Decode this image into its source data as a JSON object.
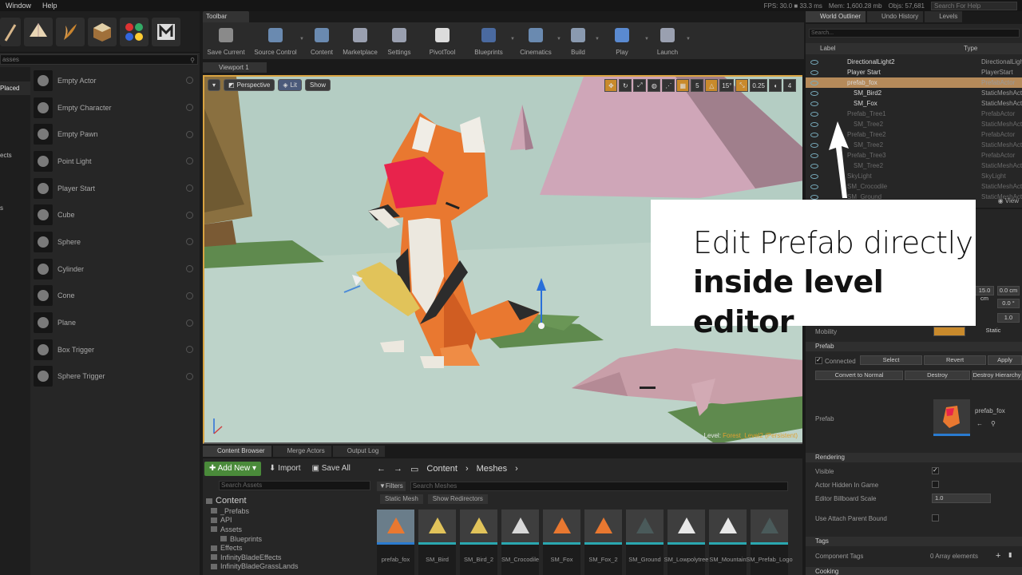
{
  "menubar": {
    "items": [
      "Window",
      "Help"
    ]
  },
  "stats": {
    "fps": "FPS: 30.0 ■ 33.3 ms",
    "mem": "Mem: 1,600.28 mb",
    "objs": "Objs: 57,681",
    "search_placeholder": "Search For Help"
  },
  "place": {
    "search_placeholder": "asses",
    "categories": [
      "Placed",
      "ects",
      "s"
    ],
    "items": [
      {
        "label": "Empty Actor",
        "icon": "sphere-icon"
      },
      {
        "label": "Empty Character",
        "icon": "character-icon"
      },
      {
        "label": "Empty Pawn",
        "icon": "pawn-icon"
      },
      {
        "label": "Point Light",
        "icon": "bulb-icon"
      },
      {
        "label": "Player Start",
        "icon": "player-start-icon"
      },
      {
        "label": "Cube",
        "icon": "cube-icon"
      },
      {
        "label": "Sphere",
        "icon": "sphere-icon"
      },
      {
        "label": "Cylinder",
        "icon": "cylinder-icon"
      },
      {
        "label": "Cone",
        "icon": "cone-icon"
      },
      {
        "label": "Plane",
        "icon": "plane-icon"
      },
      {
        "label": "Box Trigger",
        "icon": "box-trigger-icon"
      },
      {
        "label": "Sphere Trigger",
        "icon": "sphere-trigger-icon"
      }
    ]
  },
  "toolbar": {
    "tab": "Toolbar",
    "buttons": [
      {
        "label": "Save Current",
        "icon": "save-icon"
      },
      {
        "label": "Source Control",
        "icon": "source-control-icon"
      },
      {
        "label": "Content",
        "icon": "content-icon"
      },
      {
        "label": "Marketplace",
        "icon": "marketplace-icon"
      },
      {
        "label": "Settings",
        "icon": "settings-icon"
      },
      {
        "label": "PivotTool",
        "icon": "pivot-tool-icon"
      },
      {
        "label": "Blueprints",
        "icon": "blueprints-icon"
      },
      {
        "label": "Cinematics",
        "icon": "cinematics-icon"
      },
      {
        "label": "Build",
        "icon": "build-icon"
      },
      {
        "label": "Play",
        "icon": "play-icon"
      },
      {
        "label": "Launch",
        "icon": "launch-icon"
      }
    ]
  },
  "viewport": {
    "tab": "Viewport 1",
    "perspective": "Perspective",
    "lit": "Lit",
    "show": "Show",
    "snap_grid": "5",
    "snap_angle": "15°",
    "snap_scale": "0.25",
    "cam_speed": "4",
    "level_label": "Level:",
    "level_name": "Forest_Level2 (Persistent)"
  },
  "content_browser": {
    "tabs": [
      "Content Browser",
      "Merge Actors",
      "Output Log"
    ],
    "add_new": "Add New",
    "import": "Import",
    "save_all": "Save All",
    "path": [
      "Content",
      "Meshes"
    ],
    "source_search_placeholder": "Search Assets",
    "filters": "Filters",
    "mesh_search_placeholder": "Search Meshes",
    "chips": [
      "Static Mesh",
      "Show Redirectors"
    ],
    "tree": [
      "Content",
      "_Prefabs",
      "API",
      "Assets",
      "Blueprints",
      "Effects",
      "InfinityBladeEffects",
      "InfinityBladeGrassLands"
    ],
    "assets": [
      "prefab_fox",
      "SM_Bird",
      "SM_Bird_2",
      "SM_Crocodile",
      "SM_Fox",
      "SM_Fox_2",
      "SM_Ground",
      "SM_Lowpolytree",
      "SM_Mountain",
      "SM_Prefab_Logo"
    ]
  },
  "outliner": {
    "tabs": [
      "World Outliner",
      "Undo History",
      "Levels"
    ],
    "search_placeholder": "Search...",
    "col_label": "Label",
    "col_type": "Type",
    "rows": [
      {
        "name": "DirectionalLight2",
        "type": "DirectionalLight",
        "indent": 1,
        "dim": false
      },
      {
        "name": "Player Start",
        "type": "PlayerStart",
        "indent": 1,
        "dim": false
      },
      {
        "name": "prefab_fox",
        "type": "PrefabActor",
        "indent": 1,
        "dim": false
      },
      {
        "name": "SM_Bird2",
        "type": "StaticMeshActor",
        "indent": 2,
        "dim": false
      },
      {
        "name": "SM_Fox",
        "type": "StaticMeshActor",
        "indent": 2,
        "dim": false
      },
      {
        "name": "Prefab_Tree1",
        "type": "PrefabActor",
        "indent": 1,
        "dim": true
      },
      {
        "name": "SM_Tree2",
        "type": "StaticMeshActor",
        "indent": 2,
        "dim": true
      },
      {
        "name": "Prefab_Tree2",
        "type": "PrefabActor",
        "indent": 1,
        "dim": true
      },
      {
        "name": "SM_Tree2",
        "type": "StaticMeshActor",
        "indent": 2,
        "dim": true
      },
      {
        "name": "Prefab_Tree3",
        "type": "PrefabActor",
        "indent": 1,
        "dim": true
      },
      {
        "name": "SM_Tree2",
        "type": "StaticMeshActor",
        "indent": 2,
        "dim": true
      },
      {
        "name": "SkyLight",
        "type": "SkyLight",
        "indent": 1,
        "dim": true
      },
      {
        "name": "SM_Crocodile",
        "type": "StaticMeshActor",
        "indent": 1,
        "dim": true
      },
      {
        "name": "SM_Ground",
        "type": "StaticMeshActor",
        "indent": 1,
        "dim": true
      }
    ],
    "view_options": "View"
  },
  "details": {
    "transform_values": [
      "15.0 cm",
      "0.0 cm",
      "0.0 °",
      "1.0"
    ],
    "mobility_label": "Mobility",
    "mobility_static": "Static",
    "prefab_section": "Prefab",
    "connected": "Connected",
    "select": "Select",
    "revert": "Revert",
    "apply": "Apply",
    "convert_to_normal": "Convert to Normal",
    "destroy": "Destroy",
    "destroy_hierarchy": "Destroy Hierarchy",
    "prefab_label": "Prefab",
    "prefab_asset": "prefab_fox",
    "rendering_section": "Rendering",
    "visible": "Visible",
    "actor_hidden": "Actor Hidden In Game",
    "billboard_scale": "Editor Billboard Scale",
    "billboard_value": "1.0",
    "use_attach_parent": "Use Attach Parent Bound",
    "tags_section": "Tags",
    "component_tags": "Component Tags",
    "array_elements": "0 Array elements",
    "cooking_section": "Cooking"
  },
  "callout": {
    "line1": "Edit Prefab directly",
    "line2": "inside level editor"
  }
}
